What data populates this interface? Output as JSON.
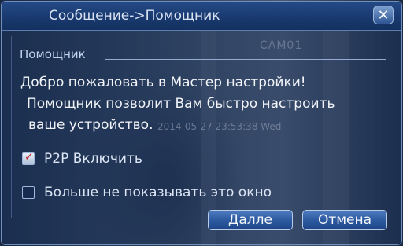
{
  "window": {
    "title": "Сообщение->Помощник",
    "close_glyph": "✕"
  },
  "camera": {
    "channel_label": "CAM01",
    "timestamp": "2014-05-27 23:53:38 Wed"
  },
  "group": {
    "title": "Помощник"
  },
  "message": {
    "line1": "Добро пожаловать в Мастер настройки!",
    "line2": "Помощник позволит Вам быстро настроить",
    "line3": "ваше устройство."
  },
  "options": {
    "p2p": {
      "label": "P2P  Включить",
      "checked": true
    },
    "dont_show": {
      "label": "Больше не показывать это окно",
      "checked": false
    }
  },
  "buttons": {
    "next_label": "Далле",
    "cancel_label": "Отмена"
  },
  "colors": {
    "accent": "#2d5aa0",
    "check_mark": "#c0282a"
  }
}
